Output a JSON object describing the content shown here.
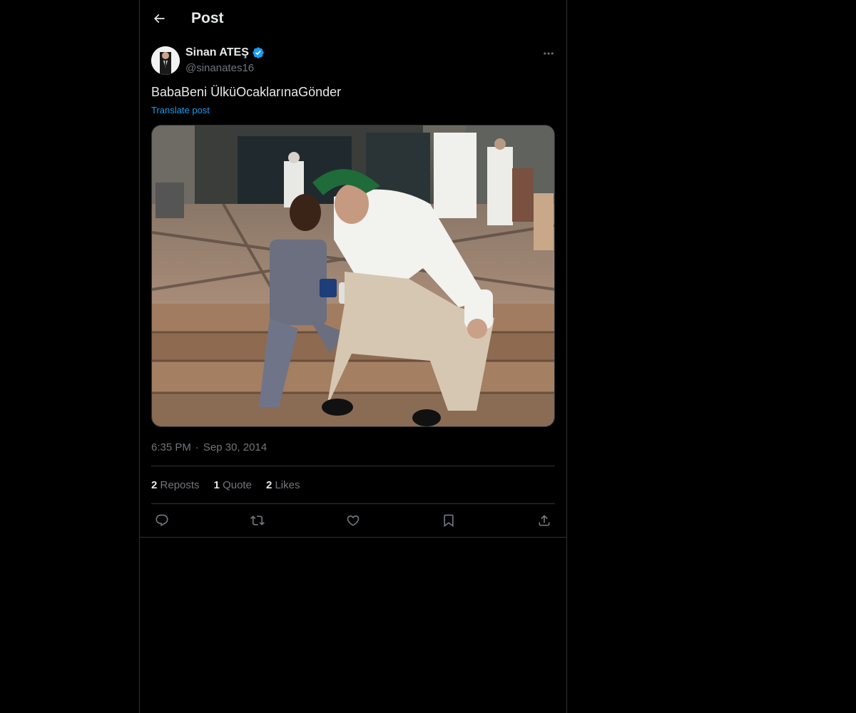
{
  "header": {
    "title": "Post",
    "back_icon": "arrow-left-icon"
  },
  "author": {
    "name": "Sinan ATEŞ",
    "handle": "@sinanates16",
    "verified": true,
    "verified_color": "#1d9bf0"
  },
  "post": {
    "text": "BabaBeni ÜlküOcaklarınaGönder",
    "translate_label": "Translate post",
    "media_alt": "Photo of a man in a white outfit and green cap sitting on steps with a young boy"
  },
  "meta": {
    "time": "6:35 PM",
    "separator": "·",
    "date": "Sep 30, 2014"
  },
  "stats": [
    {
      "num": "2",
      "label": "Reposts"
    },
    {
      "num": "1",
      "label": "Quote"
    },
    {
      "num": "2",
      "label": "Likes"
    }
  ],
  "actions": [
    "reply-icon",
    "repost-icon",
    "like-icon",
    "bookmark-icon",
    "share-icon"
  ],
  "colors": {
    "background": "#000000",
    "text": "#e7e9ea",
    "muted": "#71767b",
    "accent": "#1d9bf0",
    "border": "#2f3336"
  }
}
